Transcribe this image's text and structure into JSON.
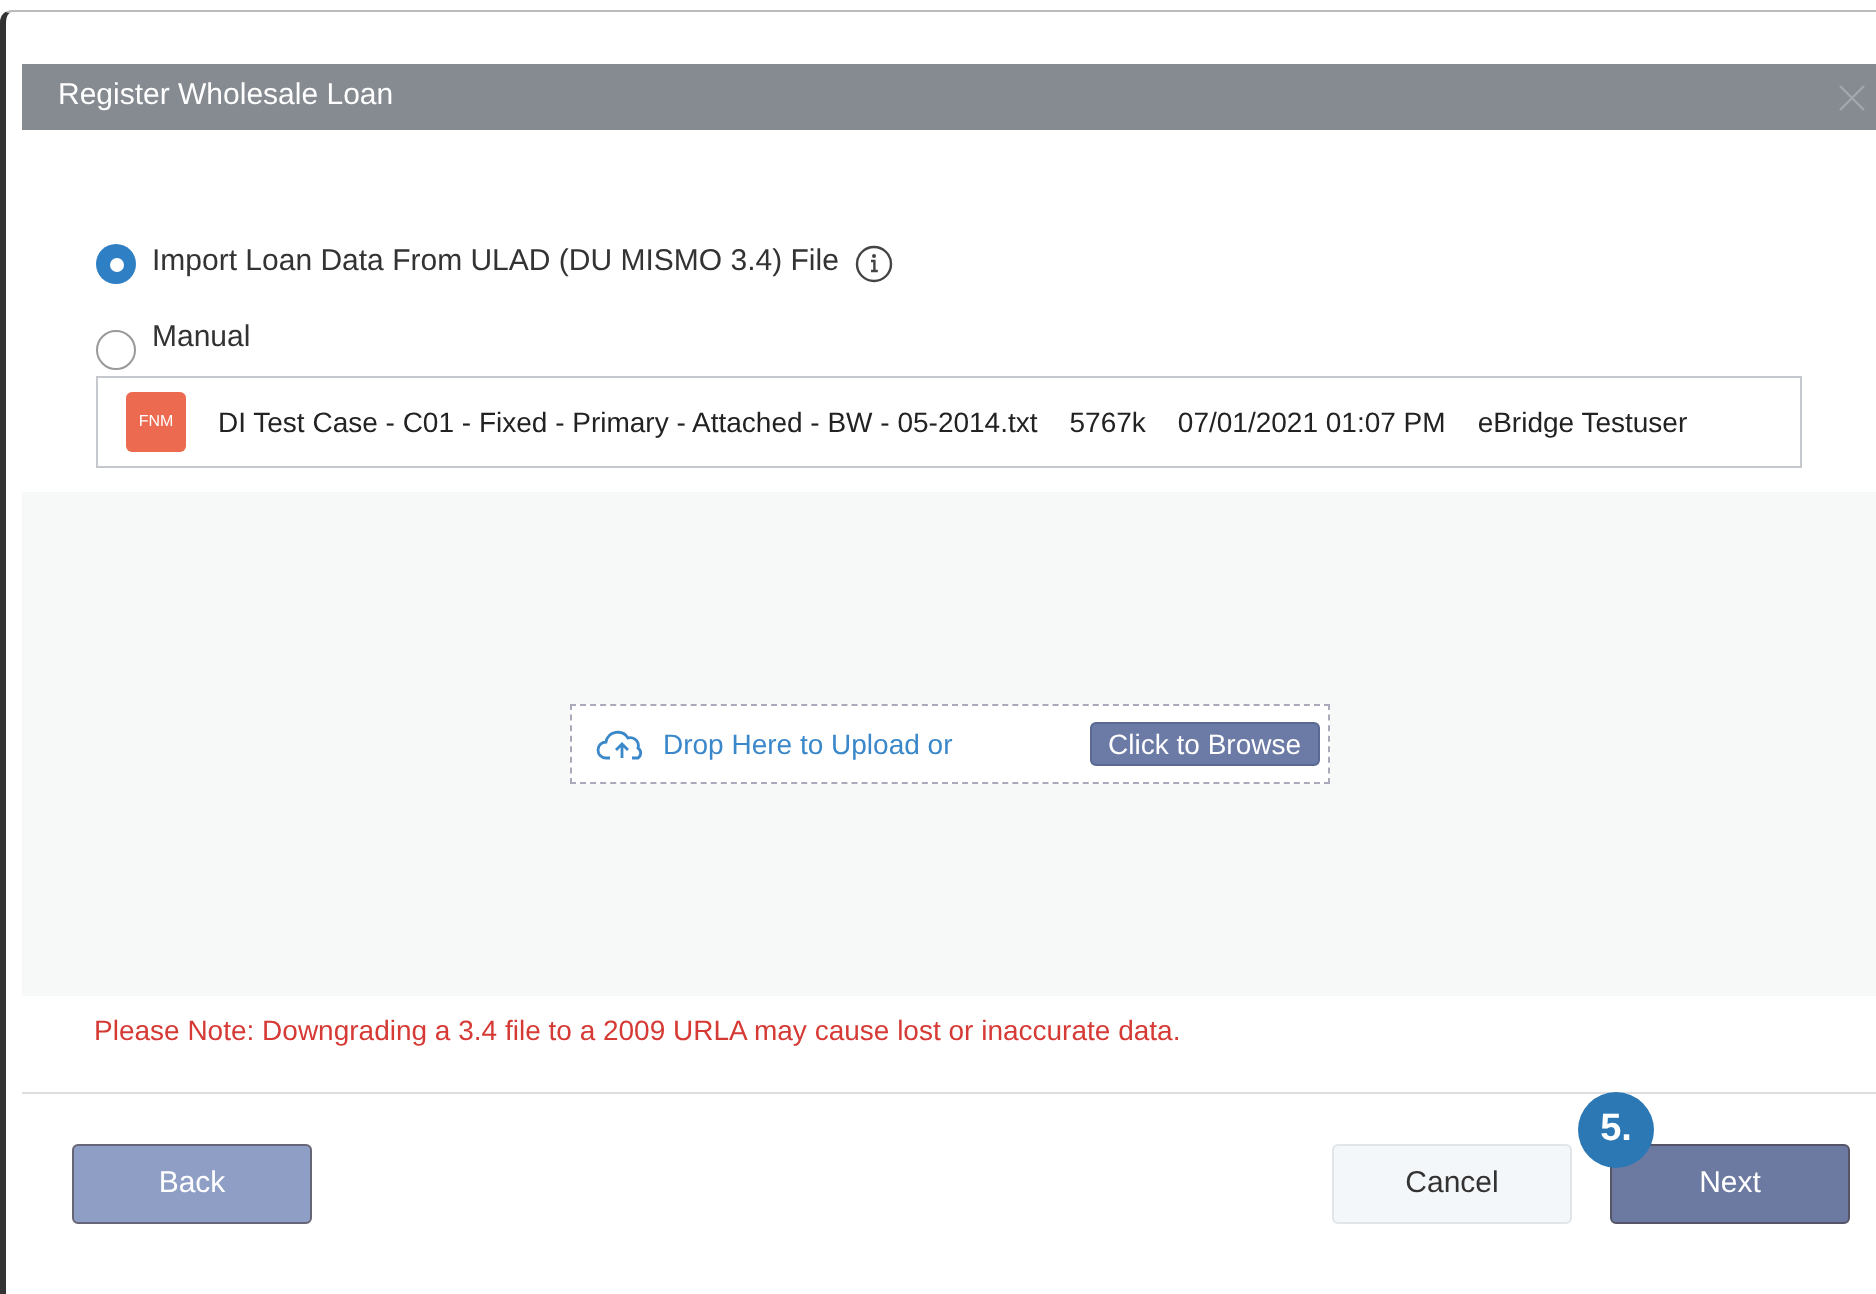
{
  "dialog": {
    "title": "Register Wholesale Loan"
  },
  "options": [
    {
      "label": "Import Loan Data From ULAD (DU MISMO 3.4) File",
      "selected": true,
      "info": true
    },
    {
      "label": "Manual",
      "selected": false,
      "info": false
    }
  ],
  "file": {
    "badge": "FNM",
    "name": "DI Test Case - C01 - Fixed - Primary - Attached - BW - 05-2014.txt",
    "size": "5767k",
    "date": "07/01/2021 01:07 PM",
    "user": "eBridge Testuser"
  },
  "dropzone": {
    "text": "Drop Here to Upload or",
    "browse": "Click to Browse"
  },
  "note": "Please Note: Downgrading a 3.4 file to a 2009 URLA may cause lost or inaccurate data.",
  "buttons": {
    "back": "Back",
    "cancel": "Cancel",
    "next": "Next"
  },
  "step_badge": "5."
}
